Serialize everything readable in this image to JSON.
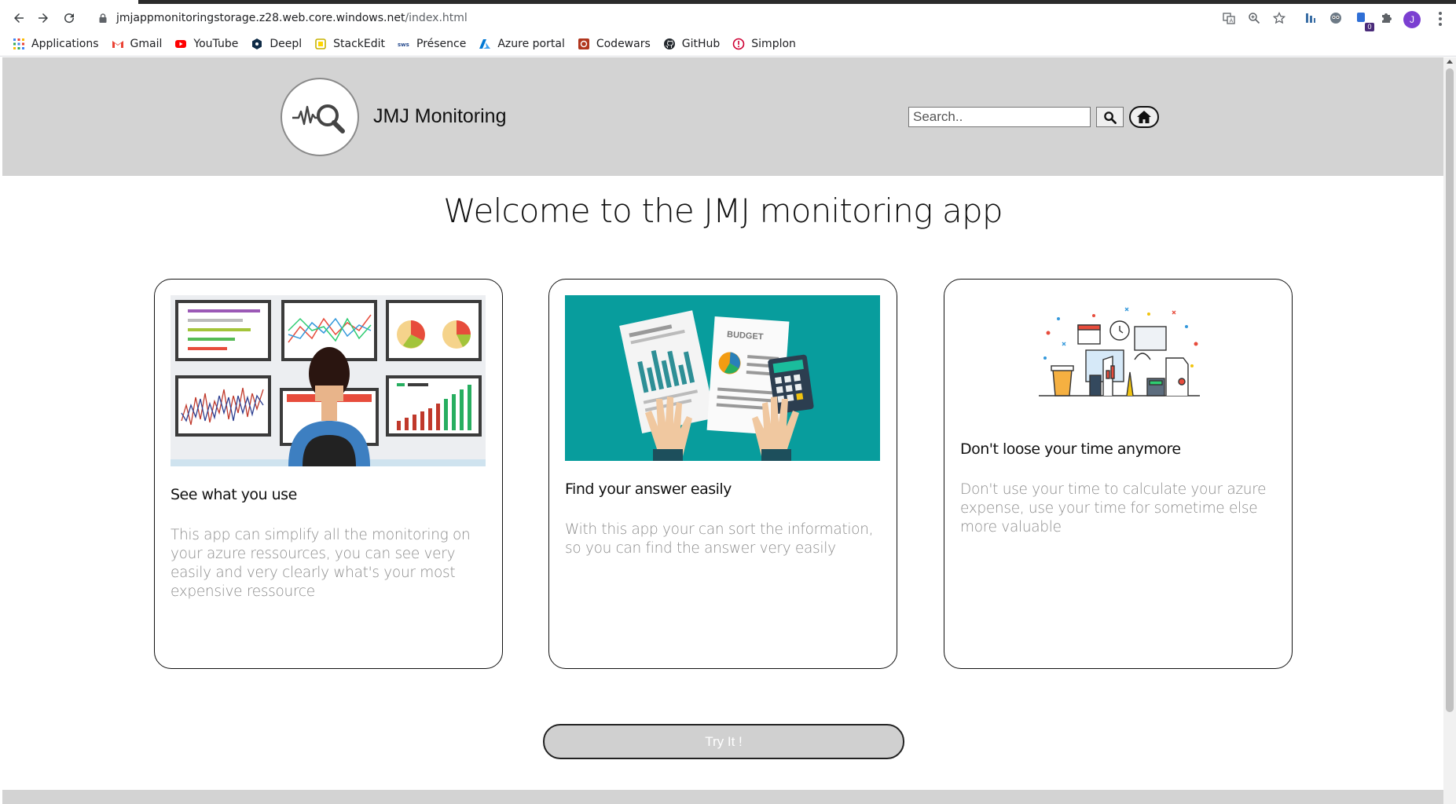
{
  "browser": {
    "url_host": "jmjappmonitoringstorage.z28.web.core.windows.net",
    "url_path": "/index.html",
    "profile_initial": "J",
    "extension_badge": "0",
    "bookmarks": [
      {
        "label": "Applications",
        "icon": "apps-grid-icon"
      },
      {
        "label": "Gmail",
        "icon": "gmail-icon"
      },
      {
        "label": "YouTube",
        "icon": "youtube-icon"
      },
      {
        "label": "Deepl",
        "icon": "deepl-icon"
      },
      {
        "label": "StackEdit",
        "icon": "stackedit-icon"
      },
      {
        "label": "Présence",
        "icon": "presence-icon"
      },
      {
        "label": "Azure portal",
        "icon": "azure-icon"
      },
      {
        "label": "Codewars",
        "icon": "codewars-icon"
      },
      {
        "label": "GitHub",
        "icon": "github-icon"
      },
      {
        "label": "Simplon",
        "icon": "simplon-icon"
      }
    ]
  },
  "header": {
    "brand": "JMJ Monitoring",
    "search_placeholder": "Search..",
    "colors": {
      "header_bg": "#d3d3d3"
    }
  },
  "main": {
    "title": "Welcome to the JMJ monitoring app",
    "cards": [
      {
        "title": "See what you use",
        "text": "This app can simplify all the monitoring on your azure ressources, you can see very easily and very clearly what's your most expensive ressource"
      },
      {
        "title": "Find your answer easily",
        "text": "With this app your can sort the information, so you can find the answer very easily",
        "image_text": "BUDGET"
      },
      {
        "title": "Don't loose your time anymore",
        "text": "Don't use your time to calculate your azure expense, use your time for sometime else more valuable"
      }
    ],
    "cta_label": "Try It !"
  }
}
